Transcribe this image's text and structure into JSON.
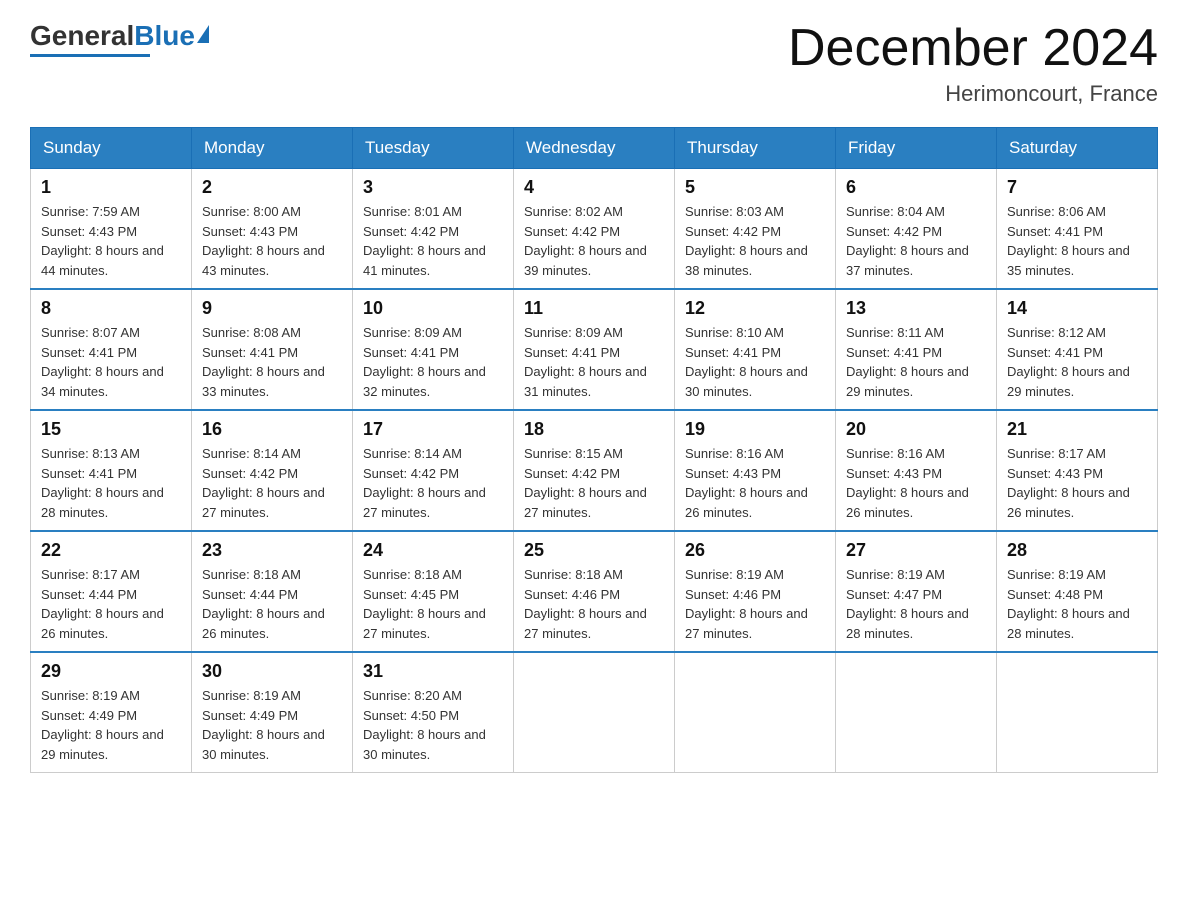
{
  "logo": {
    "general": "General",
    "blue": "Blue"
  },
  "header": {
    "title": "December 2024",
    "subtitle": "Herimoncourt, France"
  },
  "columns": [
    "Sunday",
    "Monday",
    "Tuesday",
    "Wednesday",
    "Thursday",
    "Friday",
    "Saturday"
  ],
  "weeks": [
    [
      {
        "day": "1",
        "sunrise": "7:59 AM",
        "sunset": "4:43 PM",
        "daylight": "8 hours and 44 minutes."
      },
      {
        "day": "2",
        "sunrise": "8:00 AM",
        "sunset": "4:43 PM",
        "daylight": "8 hours and 43 minutes."
      },
      {
        "day": "3",
        "sunrise": "8:01 AM",
        "sunset": "4:42 PM",
        "daylight": "8 hours and 41 minutes."
      },
      {
        "day": "4",
        "sunrise": "8:02 AM",
        "sunset": "4:42 PM",
        "daylight": "8 hours and 39 minutes."
      },
      {
        "day": "5",
        "sunrise": "8:03 AM",
        "sunset": "4:42 PM",
        "daylight": "8 hours and 38 minutes."
      },
      {
        "day": "6",
        "sunrise": "8:04 AM",
        "sunset": "4:42 PM",
        "daylight": "8 hours and 37 minutes."
      },
      {
        "day": "7",
        "sunrise": "8:06 AM",
        "sunset": "4:41 PM",
        "daylight": "8 hours and 35 minutes."
      }
    ],
    [
      {
        "day": "8",
        "sunrise": "8:07 AM",
        "sunset": "4:41 PM",
        "daylight": "8 hours and 34 minutes."
      },
      {
        "day": "9",
        "sunrise": "8:08 AM",
        "sunset": "4:41 PM",
        "daylight": "8 hours and 33 minutes."
      },
      {
        "day": "10",
        "sunrise": "8:09 AM",
        "sunset": "4:41 PM",
        "daylight": "8 hours and 32 minutes."
      },
      {
        "day": "11",
        "sunrise": "8:09 AM",
        "sunset": "4:41 PM",
        "daylight": "8 hours and 31 minutes."
      },
      {
        "day": "12",
        "sunrise": "8:10 AM",
        "sunset": "4:41 PM",
        "daylight": "8 hours and 30 minutes."
      },
      {
        "day": "13",
        "sunrise": "8:11 AM",
        "sunset": "4:41 PM",
        "daylight": "8 hours and 29 minutes."
      },
      {
        "day": "14",
        "sunrise": "8:12 AM",
        "sunset": "4:41 PM",
        "daylight": "8 hours and 29 minutes."
      }
    ],
    [
      {
        "day": "15",
        "sunrise": "8:13 AM",
        "sunset": "4:41 PM",
        "daylight": "8 hours and 28 minutes."
      },
      {
        "day": "16",
        "sunrise": "8:14 AM",
        "sunset": "4:42 PM",
        "daylight": "8 hours and 27 minutes."
      },
      {
        "day": "17",
        "sunrise": "8:14 AM",
        "sunset": "4:42 PM",
        "daylight": "8 hours and 27 minutes."
      },
      {
        "day": "18",
        "sunrise": "8:15 AM",
        "sunset": "4:42 PM",
        "daylight": "8 hours and 27 minutes."
      },
      {
        "day": "19",
        "sunrise": "8:16 AM",
        "sunset": "4:43 PM",
        "daylight": "8 hours and 26 minutes."
      },
      {
        "day": "20",
        "sunrise": "8:16 AM",
        "sunset": "4:43 PM",
        "daylight": "8 hours and 26 minutes."
      },
      {
        "day": "21",
        "sunrise": "8:17 AM",
        "sunset": "4:43 PM",
        "daylight": "8 hours and 26 minutes."
      }
    ],
    [
      {
        "day": "22",
        "sunrise": "8:17 AM",
        "sunset": "4:44 PM",
        "daylight": "8 hours and 26 minutes."
      },
      {
        "day": "23",
        "sunrise": "8:18 AM",
        "sunset": "4:44 PM",
        "daylight": "8 hours and 26 minutes."
      },
      {
        "day": "24",
        "sunrise": "8:18 AM",
        "sunset": "4:45 PM",
        "daylight": "8 hours and 27 minutes."
      },
      {
        "day": "25",
        "sunrise": "8:18 AM",
        "sunset": "4:46 PM",
        "daylight": "8 hours and 27 minutes."
      },
      {
        "day": "26",
        "sunrise": "8:19 AM",
        "sunset": "4:46 PM",
        "daylight": "8 hours and 27 minutes."
      },
      {
        "day": "27",
        "sunrise": "8:19 AM",
        "sunset": "4:47 PM",
        "daylight": "8 hours and 28 minutes."
      },
      {
        "day": "28",
        "sunrise": "8:19 AM",
        "sunset": "4:48 PM",
        "daylight": "8 hours and 28 minutes."
      }
    ],
    [
      {
        "day": "29",
        "sunrise": "8:19 AM",
        "sunset": "4:49 PM",
        "daylight": "8 hours and 29 minutes."
      },
      {
        "day": "30",
        "sunrise": "8:19 AM",
        "sunset": "4:49 PM",
        "daylight": "8 hours and 30 minutes."
      },
      {
        "day": "31",
        "sunrise": "8:20 AM",
        "sunset": "4:50 PM",
        "daylight": "8 hours and 30 minutes."
      },
      null,
      null,
      null,
      null
    ]
  ],
  "labels": {
    "sunrise": "Sunrise:",
    "sunset": "Sunset:",
    "daylight": "Daylight:"
  }
}
